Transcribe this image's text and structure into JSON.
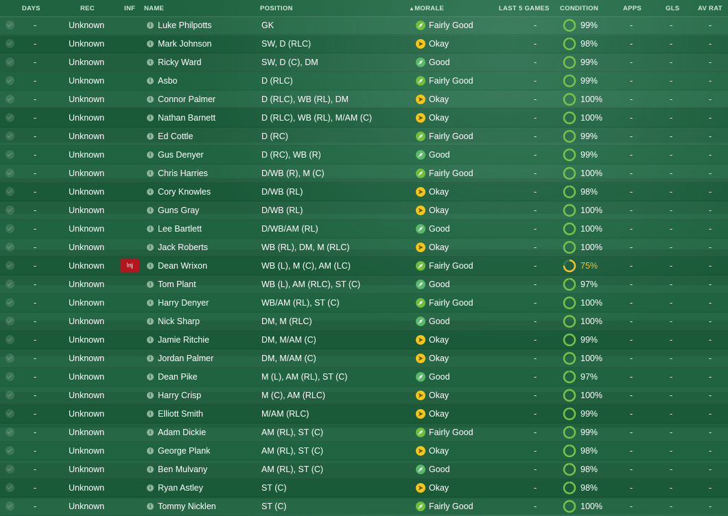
{
  "header": {
    "days": "DAYS",
    "rec": "REC",
    "inf": "INF",
    "name": "NAME",
    "position": "POSITION",
    "morale": "MORALE",
    "last5": "LAST 5 GAMES",
    "condition": "CONDITION",
    "apps": "APPS",
    "gls": "GLS",
    "avrat": "AV RAT"
  },
  "colors": {
    "fairly_good": "#6fbe3c",
    "good": "#59b86a",
    "okay": "#f5c518",
    "condition_ok": "#79c24a",
    "condition_warn": "#f2c230",
    "injury_badge": "#b3171d"
  },
  "icons": {
    "info": "info-icon",
    "morale_fairly_good": "arrow-up-right-icon",
    "morale_good": "arrow-up-right-icon",
    "morale_okay": "arrow-right-icon",
    "condition": "condition-ring-icon"
  },
  "rows": [
    {
      "days": "-",
      "rec": "Unknown",
      "inf": "",
      "name": "Luke Philpotts",
      "position": "GK",
      "morale": "Fairly Good",
      "last5": "-",
      "condition": "99%",
      "condition_value": 0.99,
      "apps": "-",
      "gls": "-",
      "avrat": "-"
    },
    {
      "days": "-",
      "rec": "Unknown",
      "inf": "",
      "name": "Mark Johnson",
      "position": "SW, D (RLC)",
      "morale": "Okay",
      "last5": "-",
      "condition": "98%",
      "condition_value": 0.98,
      "apps": "-",
      "gls": "-",
      "avrat": "-"
    },
    {
      "days": "-",
      "rec": "Unknown",
      "inf": "",
      "name": "Ricky Ward",
      "position": "SW, D (C), DM",
      "morale": "Good",
      "last5": "-",
      "condition": "99%",
      "condition_value": 0.99,
      "apps": "-",
      "gls": "-",
      "avrat": "-"
    },
    {
      "days": "-",
      "rec": "Unknown",
      "inf": "",
      "name": "Asbo",
      "position": "D (RLC)",
      "morale": "Fairly Good",
      "last5": "-",
      "condition": "99%",
      "condition_value": 0.99,
      "apps": "-",
      "gls": "-",
      "avrat": "-"
    },
    {
      "days": "-",
      "rec": "Unknown",
      "inf": "",
      "name": "Connor Palmer",
      "position": "D (RLC), WB (RL), DM",
      "morale": "Okay",
      "last5": "-",
      "condition": "100%",
      "condition_value": 1.0,
      "apps": "-",
      "gls": "-",
      "avrat": "-"
    },
    {
      "days": "-",
      "rec": "Unknown",
      "inf": "",
      "name": "Nathan Barnett",
      "position": "D (RLC), WB (RL), M/AM (C)",
      "morale": "Okay",
      "last5": "-",
      "condition": "100%",
      "condition_value": 1.0,
      "apps": "-",
      "gls": "-",
      "avrat": "-"
    },
    {
      "days": "-",
      "rec": "Unknown",
      "inf": "",
      "name": "Ed Cottle",
      "position": "D (RC)",
      "morale": "Fairly Good",
      "last5": "-",
      "condition": "99%",
      "condition_value": 0.99,
      "apps": "-",
      "gls": "-",
      "avrat": "-"
    },
    {
      "days": "-",
      "rec": "Unknown",
      "inf": "",
      "name": "Gus Denyer",
      "position": "D (RC), WB (R)",
      "morale": "Good",
      "last5": "-",
      "condition": "99%",
      "condition_value": 0.99,
      "apps": "-",
      "gls": "-",
      "avrat": "-"
    },
    {
      "days": "-",
      "rec": "Unknown",
      "inf": "",
      "name": "Chris Harries",
      "position": "D/WB (R), M (C)",
      "morale": "Fairly Good",
      "last5": "-",
      "condition": "100%",
      "condition_value": 1.0,
      "apps": "-",
      "gls": "-",
      "avrat": "-"
    },
    {
      "days": "-",
      "rec": "Unknown",
      "inf": "",
      "name": "Cory Knowles",
      "position": "D/WB (RL)",
      "morale": "Okay",
      "last5": "-",
      "condition": "98%",
      "condition_value": 0.98,
      "apps": "-",
      "gls": "-",
      "avrat": "-"
    },
    {
      "days": "-",
      "rec": "Unknown",
      "inf": "",
      "name": "Guns Gray",
      "position": "D/WB (RL)",
      "morale": "Okay",
      "last5": "-",
      "condition": "100%",
      "condition_value": 1.0,
      "apps": "-",
      "gls": "-",
      "avrat": "-"
    },
    {
      "days": "-",
      "rec": "Unknown",
      "inf": "",
      "name": "Lee Bartlett",
      "position": "D/WB/AM (RL)",
      "morale": "Good",
      "last5": "-",
      "condition": "100%",
      "condition_value": 1.0,
      "apps": "-",
      "gls": "-",
      "avrat": "-"
    },
    {
      "days": "-",
      "rec": "Unknown",
      "inf": "",
      "name": "Jack Roberts",
      "position": "WB (RL), DM, M (RLC)",
      "morale": "Okay",
      "last5": "-",
      "condition": "100%",
      "condition_value": 1.0,
      "apps": "-",
      "gls": "-",
      "avrat": "-"
    },
    {
      "days": "-",
      "rec": "Unknown",
      "inf": "Inj",
      "name": "Dean Wrixon",
      "position": "WB (L), M (C), AM (LC)",
      "morale": "Fairly Good",
      "last5": "-",
      "condition": "75%",
      "condition_value": 0.75,
      "apps": "-",
      "gls": "-",
      "avrat": "-"
    },
    {
      "days": "-",
      "rec": "Unknown",
      "inf": "",
      "name": "Tom Plant",
      "position": "WB (L), AM (RLC), ST (C)",
      "morale": "Good",
      "last5": "-",
      "condition": "97%",
      "condition_value": 0.97,
      "apps": "-",
      "gls": "-",
      "avrat": "-"
    },
    {
      "days": "-",
      "rec": "Unknown",
      "inf": "",
      "name": "Harry Denyer",
      "position": "WB/AM (RL), ST (C)",
      "morale": "Fairly Good",
      "last5": "-",
      "condition": "100%",
      "condition_value": 1.0,
      "apps": "-",
      "gls": "-",
      "avrat": "-"
    },
    {
      "days": "-",
      "rec": "Unknown",
      "inf": "",
      "name": "Nick Sharp",
      "position": "DM, M (RLC)",
      "morale": "Good",
      "last5": "-",
      "condition": "100%",
      "condition_value": 1.0,
      "apps": "-",
      "gls": "-",
      "avrat": "-"
    },
    {
      "days": "-",
      "rec": "Unknown",
      "inf": "",
      "name": "Jamie Ritchie",
      "position": "DM, M/AM (C)",
      "morale": "Okay",
      "last5": "-",
      "condition": "99%",
      "condition_value": 0.99,
      "apps": "-",
      "gls": "-",
      "avrat": "-"
    },
    {
      "days": "-",
      "rec": "Unknown",
      "inf": "",
      "name": "Jordan Palmer",
      "position": "DM, M/AM (C)",
      "morale": "Okay",
      "last5": "-",
      "condition": "100%",
      "condition_value": 1.0,
      "apps": "-",
      "gls": "-",
      "avrat": "-"
    },
    {
      "days": "-",
      "rec": "Unknown",
      "inf": "",
      "name": "Dean Pike",
      "position": "M (L), AM (RL), ST (C)",
      "morale": "Good",
      "last5": "-",
      "condition": "97%",
      "condition_value": 0.97,
      "apps": "-",
      "gls": "-",
      "avrat": "-"
    },
    {
      "days": "-",
      "rec": "Unknown",
      "inf": "",
      "name": "Harry Crisp",
      "position": "M (C), AM (RLC)",
      "morale": "Okay",
      "last5": "-",
      "condition": "100%",
      "condition_value": 1.0,
      "apps": "-",
      "gls": "-",
      "avrat": "-"
    },
    {
      "days": "-",
      "rec": "Unknown",
      "inf": "",
      "name": "Elliott Smith",
      "position": "M/AM (RLC)",
      "morale": "Okay",
      "last5": "-",
      "condition": "99%",
      "condition_value": 0.99,
      "apps": "-",
      "gls": "-",
      "avrat": "-"
    },
    {
      "days": "-",
      "rec": "Unknown",
      "inf": "",
      "name": "Adam Dickie",
      "position": "AM (RL), ST (C)",
      "morale": "Fairly Good",
      "last5": "-",
      "condition": "99%",
      "condition_value": 0.99,
      "apps": "-",
      "gls": "-",
      "avrat": "-"
    },
    {
      "days": "-",
      "rec": "Unknown",
      "inf": "",
      "name": "George Plank",
      "position": "AM (RL), ST (C)",
      "morale": "Okay",
      "last5": "-",
      "condition": "98%",
      "condition_value": 0.98,
      "apps": "-",
      "gls": "-",
      "avrat": "-"
    },
    {
      "days": "-",
      "rec": "Unknown",
      "inf": "",
      "name": "Ben Mulvany",
      "position": "AM (RL), ST (C)",
      "morale": "Good",
      "last5": "-",
      "condition": "98%",
      "condition_value": 0.98,
      "apps": "-",
      "gls": "-",
      "avrat": "-"
    },
    {
      "days": "-",
      "rec": "Unknown",
      "inf": "",
      "name": "Ryan Astley",
      "position": "ST (C)",
      "morale": "Okay",
      "last5": "-",
      "condition": "98%",
      "condition_value": 0.98,
      "apps": "-",
      "gls": "-",
      "avrat": "-"
    },
    {
      "days": "-",
      "rec": "Unknown",
      "inf": "",
      "name": "Tommy Nicklen",
      "position": "ST (C)",
      "morale": "Fairly Good",
      "last5": "-",
      "condition": "100%",
      "condition_value": 1.0,
      "apps": "-",
      "gls": "-",
      "avrat": "-"
    }
  ]
}
